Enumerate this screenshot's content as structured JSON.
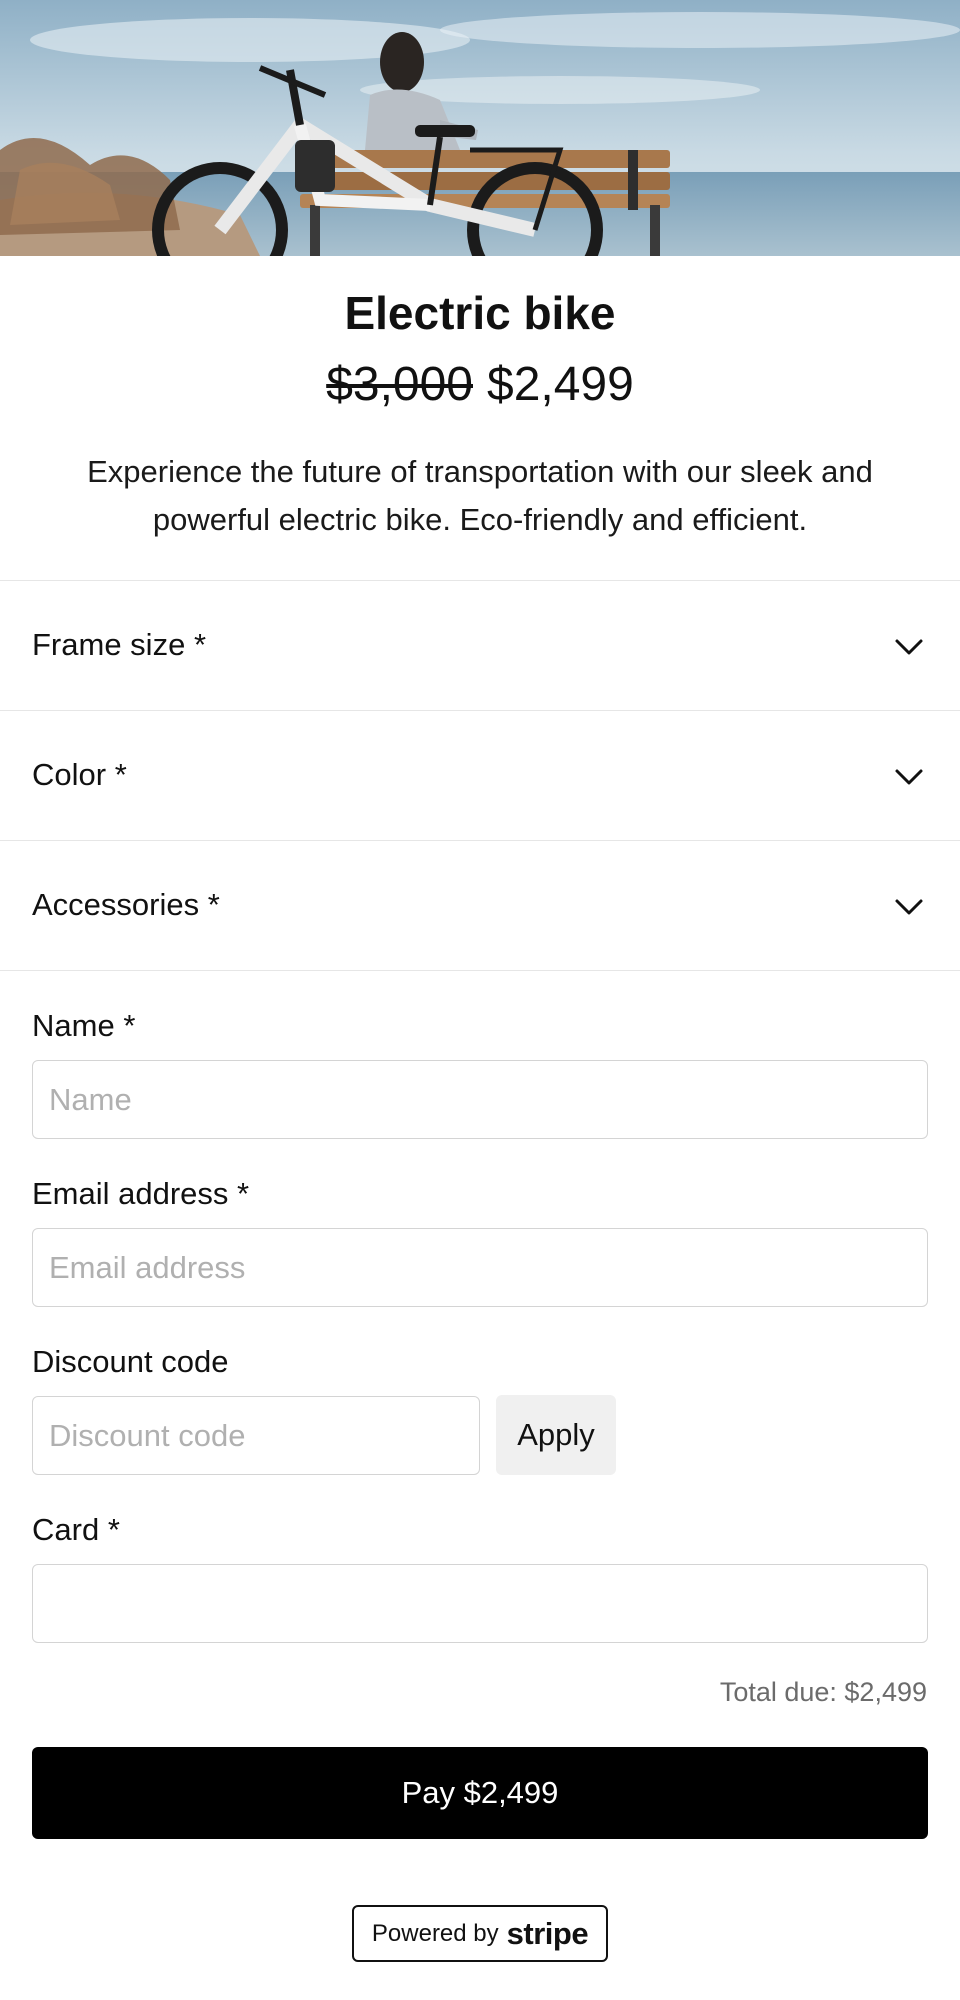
{
  "product": {
    "title": "Electric bike",
    "original_price": "$3,000",
    "price": "$2,499",
    "description": "Experience the future of transportation with our sleek and powerful electric bike. Eco-friendly and efficient."
  },
  "options": [
    {
      "label": "Frame size",
      "required_mark": "*"
    },
    {
      "label": "Color",
      "required_mark": "*"
    },
    {
      "label": "Accessories",
      "required_mark": "*"
    }
  ],
  "form": {
    "name": {
      "label": "Name",
      "required_mark": "*",
      "placeholder": "Name",
      "value": ""
    },
    "email": {
      "label": "Email address",
      "required_mark": "*",
      "placeholder": "Email address",
      "value": ""
    },
    "discount": {
      "label": "Discount code",
      "placeholder": "Discount code",
      "value": "",
      "apply_label": "Apply"
    },
    "card": {
      "label": "Card",
      "required_mark": "*"
    }
  },
  "checkout": {
    "total_due": "Total due: $2,499",
    "pay_label": "Pay $2,499"
  },
  "footer": {
    "powered_text": "Powered by",
    "brand": "stripe"
  },
  "icons": {
    "chevron": "chevron-down-icon",
    "hero": "product-photo"
  },
  "colors": {
    "pay_button": "#000000",
    "apply_button": "#f0f0f0",
    "divider": "#e6e6e6",
    "muted_text": "#6b6b6b"
  }
}
